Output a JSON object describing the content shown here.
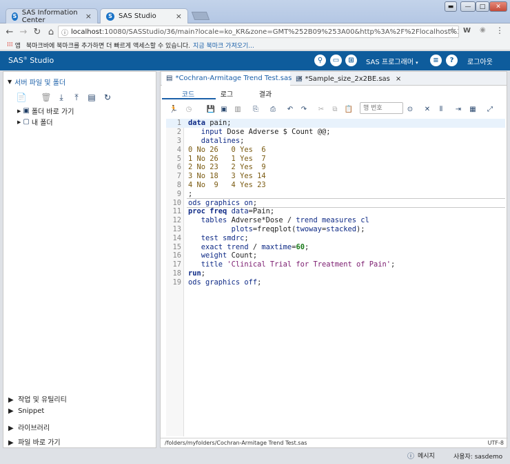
{
  "browser": {
    "tabs": [
      {
        "label": "SAS Information Center"
      },
      {
        "label": "SAS Studio"
      }
    ],
    "url_host": "localhost",
    "url_rest": ":10080/SASStudio/36/main?locale=ko_KR&zone=GMT%252B09%253A00&http%3A%2F%2Flocalhost%3A10080%2FS...",
    "bookmarks_apps": "앱",
    "bookmarks_text": "북마크바에 북마크를 추가하면 더 빠르게 액세스할 수 있습니다.",
    "bookmarks_link": "지금 북마크 가져오기..."
  },
  "sas_header": {
    "brand": "SAS",
    "brand_sup": "®",
    "brand_suffix": "Studio",
    "program_menu": "SAS 프로그래머",
    "logout": "로그아웃"
  },
  "left_panel": {
    "title": "서버 파일 및 폴더",
    "tree": [
      {
        "label": "폴더 바로 가기"
      },
      {
        "label": "내 폴더"
      }
    ],
    "accordions": [
      {
        "label": "작업 및 유틸리티"
      },
      {
        "label": "Snippet"
      },
      {
        "label": "라이브러리"
      },
      {
        "label": "파일 바로 가기"
      }
    ]
  },
  "editor_tabs": [
    {
      "label": "*Cochran-Armitage Trend Test.sas"
    },
    {
      "label": "*Sample_size_2x2BE.sas"
    }
  ],
  "sub_tabs": {
    "code": "코드",
    "log": "로그",
    "results": "결과"
  },
  "line_input_placeholder": "행 번호",
  "code_lines": [
    {
      "num": "1"
    },
    {
      "num": "2"
    },
    {
      "num": "3"
    },
    {
      "num": "4"
    },
    {
      "num": "5"
    },
    {
      "num": "6"
    },
    {
      "num": "7"
    },
    {
      "num": "8"
    },
    {
      "num": "9"
    },
    {
      "num": "10"
    },
    {
      "num": "11"
    },
    {
      "num": "12"
    },
    {
      "num": "13"
    },
    {
      "num": "14"
    },
    {
      "num": "15"
    },
    {
      "num": "16"
    },
    {
      "num": "17"
    },
    {
      "num": "18"
    },
    {
      "num": "19"
    }
  ],
  "code_tokens": {
    "l1": [
      "data",
      " pain;"
    ],
    "l2": [
      "   ",
      "input",
      " Dose Adverse $ Count @@;"
    ],
    "l3": [
      "   ",
      "datalines",
      ";"
    ],
    "l4": "0 No 26   0 Yes  6",
    "l5": "1 No 26   1 Yes  7",
    "l6": "2 No 23   2 Yes  9",
    "l7": "3 No 18   3 Yes 14",
    "l8": "4 No  9   4 Yes 23",
    "l9": ";",
    "l10": [
      "ods graphics on",
      ";"
    ],
    "l11": [
      "proc freq",
      " ",
      "data",
      "=Pain;"
    ],
    "l12": [
      "   ",
      "tables",
      " Adverse*Dose / ",
      "trend measures cl"
    ],
    "l13": [
      "          ",
      "plots",
      "=freqplot(",
      "twoway",
      "=",
      "stacked",
      ");"
    ],
    "l14": [
      "   ",
      "test",
      " ",
      "smdrc",
      ";"
    ],
    "l15": [
      "   ",
      "exact trend",
      " / ",
      "maxtime",
      "=",
      "60",
      ";"
    ],
    "l16": [
      "   ",
      "weight",
      " Count;"
    ],
    "l17": [
      "   ",
      "title",
      " ",
      "'Clinical Trial for Treatment of Pain'",
      ";"
    ],
    "l18": [
      "run",
      ";"
    ],
    "l19": [
      "ods graphics off",
      ";"
    ]
  },
  "status": {
    "path": "/folders/myfolders/Cochran-Armitage Trend Test.sas",
    "encoding": "UTF-8"
  },
  "bottom": {
    "messages": "메시지",
    "user": "사용자: sasdemo"
  },
  "colors": {
    "header_bg": "#0e5c9c",
    "keyword": "#0e2a86",
    "string": "#7a1a6e",
    "number": "#1a7a1a",
    "data_line": "#7a5a10",
    "link": "#1a5fa8"
  }
}
